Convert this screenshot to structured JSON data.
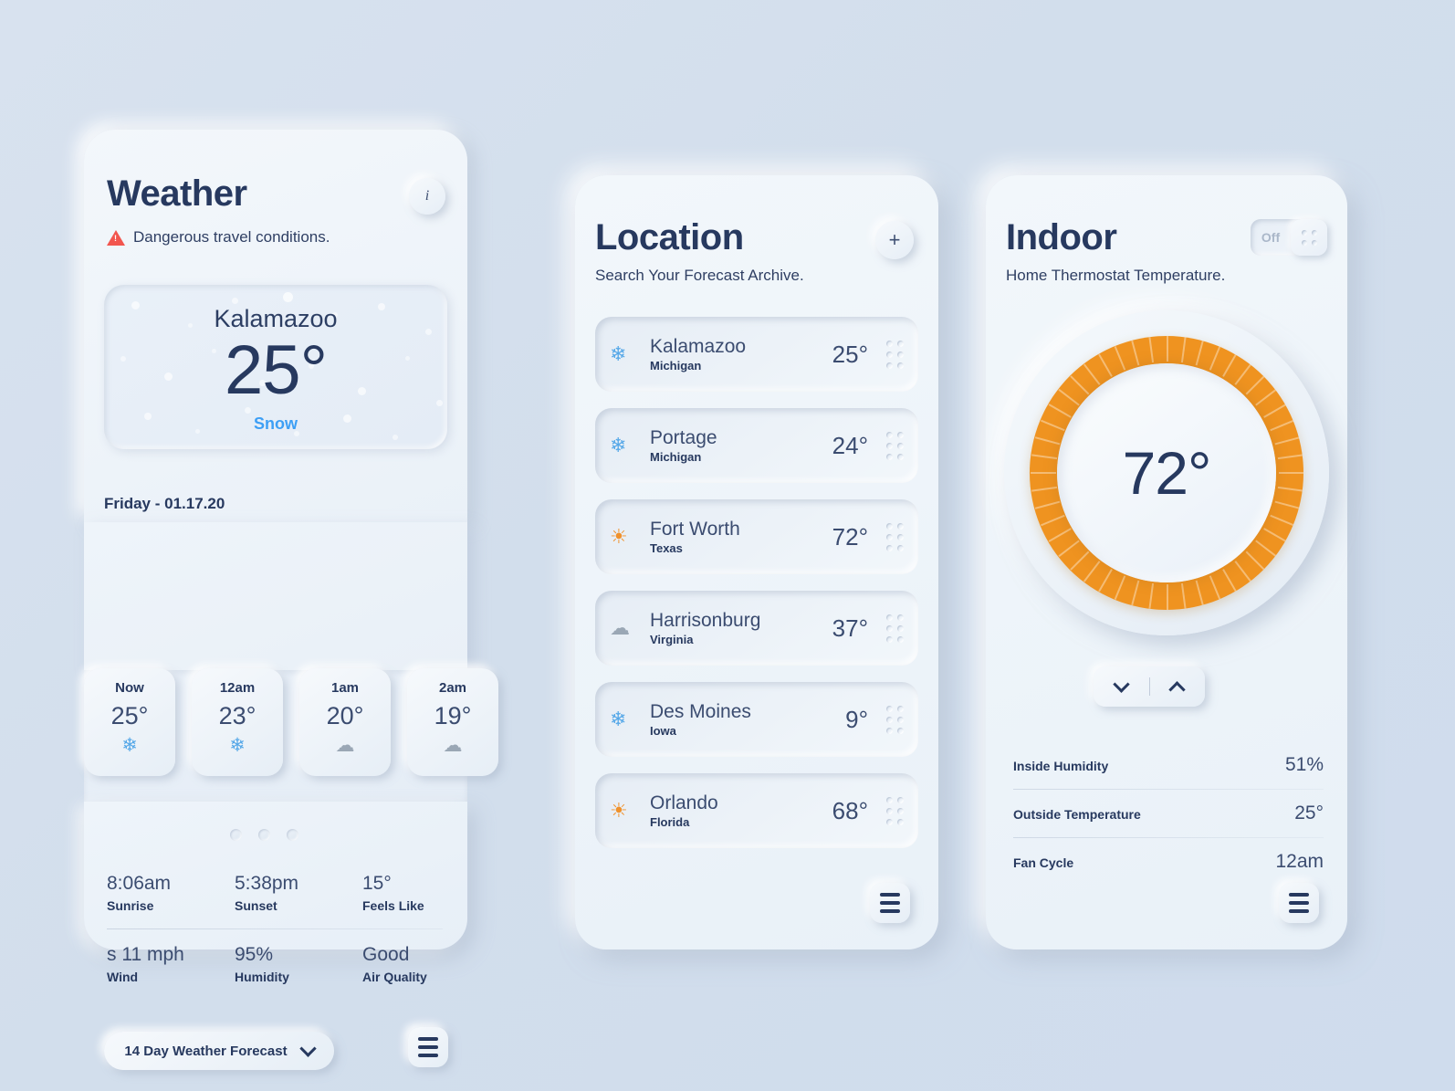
{
  "weather": {
    "title": "Weather",
    "warning": "Dangerous travel conditions.",
    "info_icon": "i",
    "hero": {
      "city": "Kalamazoo",
      "temp": "25°",
      "condition": "Snow"
    },
    "date": "Friday - 01.17.20",
    "hourly": [
      {
        "label": "Now",
        "temp": "25°",
        "icon": "❄",
        "icon_name": "snowflake-icon"
      },
      {
        "label": "12am",
        "temp": "23°",
        "icon": "❄",
        "icon_name": "snowflake-icon"
      },
      {
        "label": "1am",
        "temp": "20°",
        "icon": "☁",
        "icon_name": "cloud-icon"
      },
      {
        "label": "2am",
        "temp": "19°",
        "icon": "☁",
        "icon_name": "cloud-icon"
      }
    ],
    "stats": [
      {
        "value": "8:06am",
        "label": "Sunrise"
      },
      {
        "value": "5:38pm",
        "label": "Sunset"
      },
      {
        "value": "15°",
        "label": "Feels Like"
      },
      {
        "value": "s 11 mph",
        "label": "Wind"
      },
      {
        "value": "95%",
        "label": "Humidity"
      },
      {
        "value": "Good",
        "label": "Air Quality"
      }
    ],
    "forecast_select": "14 Day Weather Forecast",
    "pager_dots": 3
  },
  "location": {
    "title": "Location",
    "subtitle": "Search Your Forecast Archive.",
    "add_label": "+",
    "items": [
      {
        "city": "Kalamazoo",
        "state": "Michigan",
        "temp": "25°",
        "icon": "❄",
        "icon_name": "snowflake-icon"
      },
      {
        "city": "Portage",
        "state": "Michigan",
        "temp": "24°",
        "icon": "❄",
        "icon_name": "snowflake-icon"
      },
      {
        "city": "Fort Worth",
        "state": "Texas",
        "temp": "72°",
        "icon": "☀",
        "icon_name": "sun-icon"
      },
      {
        "city": "Harrisonburg",
        "state": "Virginia",
        "temp": "37°",
        "icon": "☁",
        "icon_name": "cloud-icon"
      },
      {
        "city": "Des Moines",
        "state": "Iowa",
        "temp": "9°",
        "icon": "❄",
        "icon_name": "snowflake-icon"
      },
      {
        "city": "Orlando",
        "state": "Florida",
        "temp": "68°",
        "icon": "☀",
        "icon_name": "sun-icon"
      }
    ]
  },
  "indoor": {
    "title": "Indoor",
    "subtitle": "Home Thermostat Temperature.",
    "toggle_label": "Off",
    "dial_temp": "72°",
    "stats": [
      {
        "label": "Inside Humidity",
        "value": "51%"
      },
      {
        "label": "Outside Temperature",
        "value": "25°"
      },
      {
        "label": "Fan Cycle",
        "value": "12am"
      }
    ]
  },
  "colors": {
    "background": "#d5e0ee",
    "panel": "#eef4fa",
    "navy": "#27395f",
    "accent_orange": "#ef9320",
    "accent_blue": "#3d9ff5",
    "warning_red": "#f2564e"
  }
}
